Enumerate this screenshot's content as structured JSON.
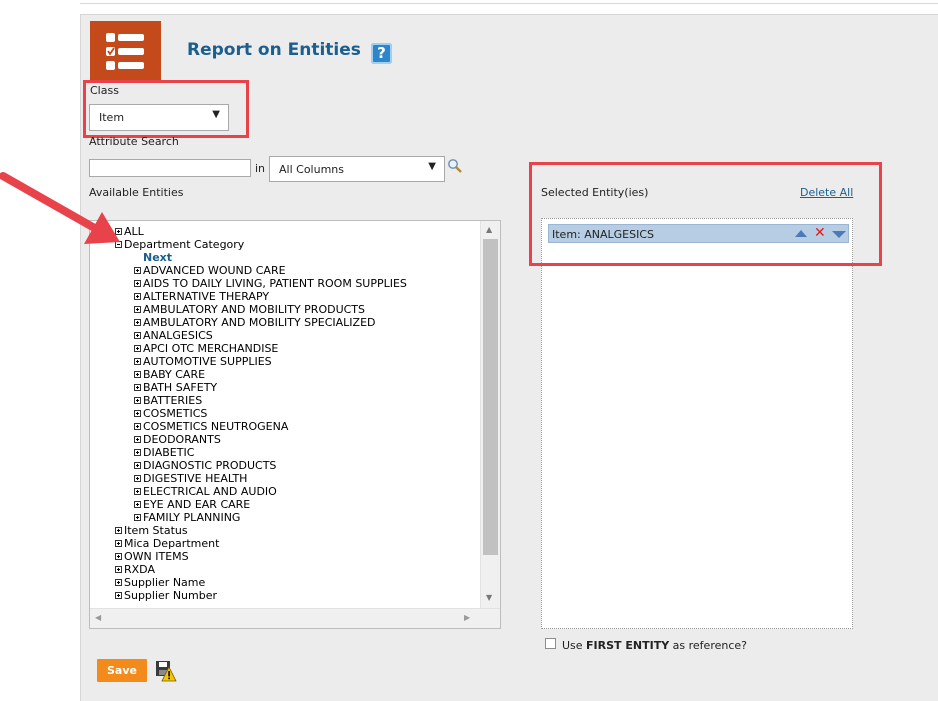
{
  "page": {
    "title": "Report on Entities",
    "help_label": "?"
  },
  "class_field": {
    "label": "Class",
    "value": "Item"
  },
  "attribute_search": {
    "label": "Attribute Search",
    "value": "",
    "in_label": "in",
    "columns_value": "All Columns"
  },
  "available": {
    "label": "Available Entities",
    "tree": [
      {
        "label": "ALL",
        "expanded": false,
        "level": 0
      },
      {
        "label": "Department Category",
        "expanded": true,
        "level": 0
      },
      {
        "label": "Next",
        "link": true
      },
      {
        "label": "ADVANCED WOUND CARE",
        "level": 1
      },
      {
        "label": "AIDS TO DAILY LIVING, PATIENT ROOM SUPPLIES",
        "level": 1
      },
      {
        "label": "ALTERNATIVE THERAPY",
        "level": 1
      },
      {
        "label": "AMBULATORY AND MOBILITY PRODUCTS",
        "level": 1
      },
      {
        "label": "AMBULATORY AND MOBILITY SPECIALIZED",
        "level": 1
      },
      {
        "label": "ANALGESICS",
        "level": 1
      },
      {
        "label": "APCI OTC MERCHANDISE",
        "level": 1
      },
      {
        "label": "AUTOMOTIVE SUPPLIES",
        "level": 1
      },
      {
        "label": "BABY CARE",
        "level": 1
      },
      {
        "label": "BATH SAFETY",
        "level": 1
      },
      {
        "label": "BATTERIES",
        "level": 1
      },
      {
        "label": "COSMETICS",
        "level": 1
      },
      {
        "label": "COSMETICS NEUTROGENA",
        "level": 1
      },
      {
        "label": "DEODORANTS",
        "level": 1
      },
      {
        "label": "DIABETIC",
        "level": 1
      },
      {
        "label": "DIAGNOSTIC PRODUCTS",
        "level": 1
      },
      {
        "label": "DIGESTIVE HEALTH",
        "level": 1
      },
      {
        "label": "ELECTRICAL AND AUDIO",
        "level": 1
      },
      {
        "label": "EYE AND EAR CARE",
        "level": 1
      },
      {
        "label": "FAMILY PLANNING",
        "level": 1
      },
      {
        "label": "Item Status",
        "level": 0
      },
      {
        "label": "Mica Department",
        "level": 0
      },
      {
        "label": "OWN ITEMS",
        "level": 0
      },
      {
        "label": "RXDA",
        "level": 0
      },
      {
        "label": "Supplier Name",
        "level": 0
      },
      {
        "label": "Supplier Number",
        "level": 0
      }
    ]
  },
  "selected": {
    "label": "Selected Entity(ies)",
    "delete_all": "Delete All",
    "items": [
      {
        "label": "Item: ANALGESICS"
      }
    ]
  },
  "reference": {
    "prefix": "Use ",
    "bold": "FIRST ENTITY",
    "suffix": " as reference?"
  },
  "actions": {
    "save_label": "Save"
  },
  "colors": {
    "accent": "#c4491b",
    "title": "#1a5f8e",
    "highlight": "#e8434b",
    "save": "#f28b1c",
    "selected_row": "#b7cde3"
  }
}
